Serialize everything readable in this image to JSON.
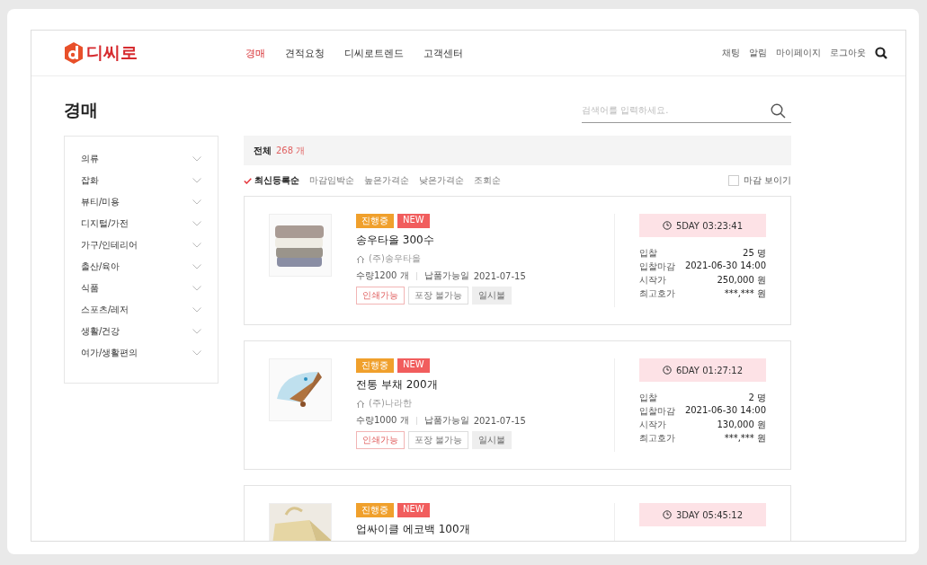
{
  "header": {
    "logo": "디씨로",
    "nav": [
      {
        "label": "경매",
        "selected": true
      },
      {
        "label": "견적요청",
        "selected": false
      },
      {
        "label": "디씨로트렌드",
        "selected": false
      },
      {
        "label": "고객센터",
        "selected": false
      }
    ],
    "links": [
      "채팅",
      "알림",
      "마이페이지",
      "로그아웃"
    ]
  },
  "page_title": "경매",
  "search": {
    "placeholder": "검색어를 입력하세요."
  },
  "categories": [
    "의류",
    "잡화",
    "뷰티/미용",
    "디지털/가전",
    "가구/인테리어",
    "출산/육아",
    "식품",
    "스포츠/레저",
    "생활/건강",
    "여가/생활편의"
  ],
  "total": {
    "label": "전체",
    "count": "268 개"
  },
  "sort_options": [
    {
      "label": "최신등록순",
      "selected": true
    },
    {
      "label": "마감임박순",
      "selected": false
    },
    {
      "label": "높은가격순",
      "selected": false
    },
    {
      "label": "낮은가격순",
      "selected": false
    },
    {
      "label": "조회순",
      "selected": false
    }
  ],
  "show_closed": {
    "label": "마감 보이기",
    "checked": false
  },
  "auctions": [
    {
      "badges": [
        {
          "label": "진행중",
          "kind": "status"
        },
        {
          "label": "NEW",
          "kind": "new"
        }
      ],
      "title": "송우타올 300수",
      "seller": "(주)송우타올",
      "quantity": "수량1200 개",
      "delivery_label": "납품가능일",
      "delivery": "2021-07-15",
      "tags": [
        {
          "label": "인쇄가능",
          "kind": "positive"
        },
        {
          "label": "포장 불가능",
          "kind": "outline"
        },
        {
          "label": "일시불",
          "kind": "filled"
        }
      ],
      "timer": "5DAY 03:23:41",
      "stats": [
        {
          "label": "입찰",
          "value": "25 명"
        },
        {
          "label": "입찰마감",
          "value": "2021-06-30 14:00"
        },
        {
          "label": "시작가",
          "value": "250,000 원"
        },
        {
          "label": "최고호가",
          "value": "***,*** 원"
        }
      ]
    },
    {
      "badges": [
        {
          "label": "진행중",
          "kind": "status"
        },
        {
          "label": "NEW",
          "kind": "new"
        }
      ],
      "title": "전통 부채 200개",
      "seller": "(주)나라한",
      "quantity": "수량1000 개",
      "delivery_label": "납품가능일",
      "delivery": "2021-07-15",
      "tags": [
        {
          "label": "인쇄가능",
          "kind": "positive"
        },
        {
          "label": "포장 불가능",
          "kind": "outline"
        },
        {
          "label": "일시불",
          "kind": "filled"
        }
      ],
      "timer": "6DAY 01:27:12",
      "stats": [
        {
          "label": "입찰",
          "value": "2 명"
        },
        {
          "label": "입찰마감",
          "value": "2021-06-30 14:00"
        },
        {
          "label": "시작가",
          "value": "130,000 원"
        },
        {
          "label": "최고호가",
          "value": "***,*** 원"
        }
      ]
    },
    {
      "badges": [
        {
          "label": "진행중",
          "kind": "status"
        },
        {
          "label": "NEW",
          "kind": "new"
        }
      ],
      "title": "업싸이클 에코백 100개",
      "timer": "3DAY 05:45:12"
    }
  ]
}
